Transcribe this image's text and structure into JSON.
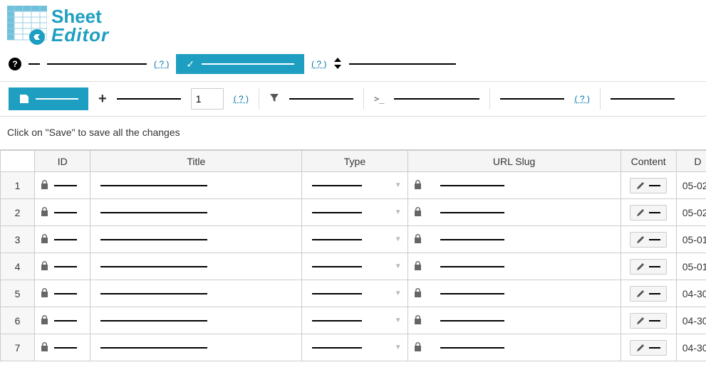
{
  "logo": {
    "line1": "Sheet",
    "line2": "Editor"
  },
  "actionrow": {
    "help1": "( ? )",
    "help2": "( ? )"
  },
  "toolbar2": {
    "pageValue": "1",
    "help": "( ? )",
    "help2": "( ? )"
  },
  "hint": "Click on \"Save\" to save all the changes",
  "columns": {
    "id": "ID",
    "title": "Title",
    "type": "Type",
    "slug": "URL Slug",
    "content": "Content",
    "date": "D"
  },
  "rows": [
    {
      "n": "1",
      "date": "05-02"
    },
    {
      "n": "2",
      "date": "05-02"
    },
    {
      "n": "3",
      "date": "05-01"
    },
    {
      "n": "4",
      "date": "05-01"
    },
    {
      "n": "5",
      "date": "04-30"
    },
    {
      "n": "6",
      "date": "04-30"
    },
    {
      "n": "7",
      "date": "04-30"
    }
  ]
}
